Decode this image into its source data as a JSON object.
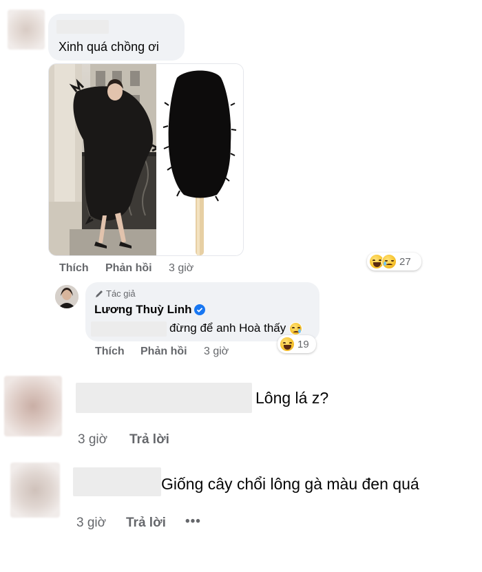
{
  "comment1": {
    "text": "Xinh quá chồng ơi",
    "actions": {
      "like": "Thích",
      "reply": "Phản hồi",
      "time": "3 giờ"
    },
    "reaction_count": "27",
    "reaction_icons": [
      "laughing-emoji",
      "crying-emoji"
    ]
  },
  "reply1": {
    "author_badge": "Tác giả",
    "author_name": "Lương Thuỳ Linh",
    "text": "đừng để anh Hoà thấy",
    "actions": {
      "like": "Thích",
      "reply": "Phản hồi",
      "time": "3 giờ"
    },
    "reaction_count": "19",
    "reaction_icons": [
      "laughing-emoji"
    ]
  },
  "comment2": {
    "text": "Lông lá z?",
    "actions": {
      "time": "3 giờ",
      "reply": "Trả lời"
    }
  },
  "comment3": {
    "text": "Giống cây chổi lông gà màu đen quá",
    "actions": {
      "time": "3 giờ",
      "reply": "Trả lời",
      "more": "•••"
    }
  },
  "colors": {
    "bubble": "#f0f2f5",
    "meta_text": "#65676b",
    "verified": "#1877f2"
  }
}
